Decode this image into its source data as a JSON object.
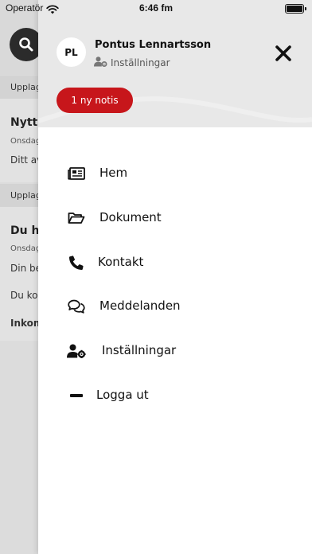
{
  "status_bar": {
    "carrier": "Operatör",
    "time": "6:46 fm"
  },
  "background": {
    "section1": "Upplag",
    "card1_title": "Nytt",
    "card1_date": "Onsdag",
    "card1_body": "Ditt av",
    "section2": "Upplag",
    "card2_title": "Du ha",
    "card2_date": "Onsdag",
    "card2_line1": "Din be",
    "card2_line2": "Du ko",
    "card2_line3": "Inkom"
  },
  "drawer": {
    "avatar_initials": "PL",
    "user_name": "Pontus Lennartsson",
    "settings_link": "Inställningar",
    "notification_button": "1 ny notis",
    "menu": [
      {
        "label": "Hem",
        "icon": "newspaper-icon"
      },
      {
        "label": "Dokument",
        "icon": "folder-open-icon"
      },
      {
        "label": "Kontakt",
        "icon": "phone-icon"
      },
      {
        "label": "Meddelanden",
        "icon": "chat-bubbles-icon"
      },
      {
        "label": "Inställningar",
        "icon": "user-gear-icon"
      },
      {
        "label": "Logga ut",
        "icon": "minus-icon"
      }
    ]
  },
  "colors": {
    "accent": "#c7161b",
    "drawer_header": "#e8e8e8",
    "overlay": "#dcdcdc"
  }
}
